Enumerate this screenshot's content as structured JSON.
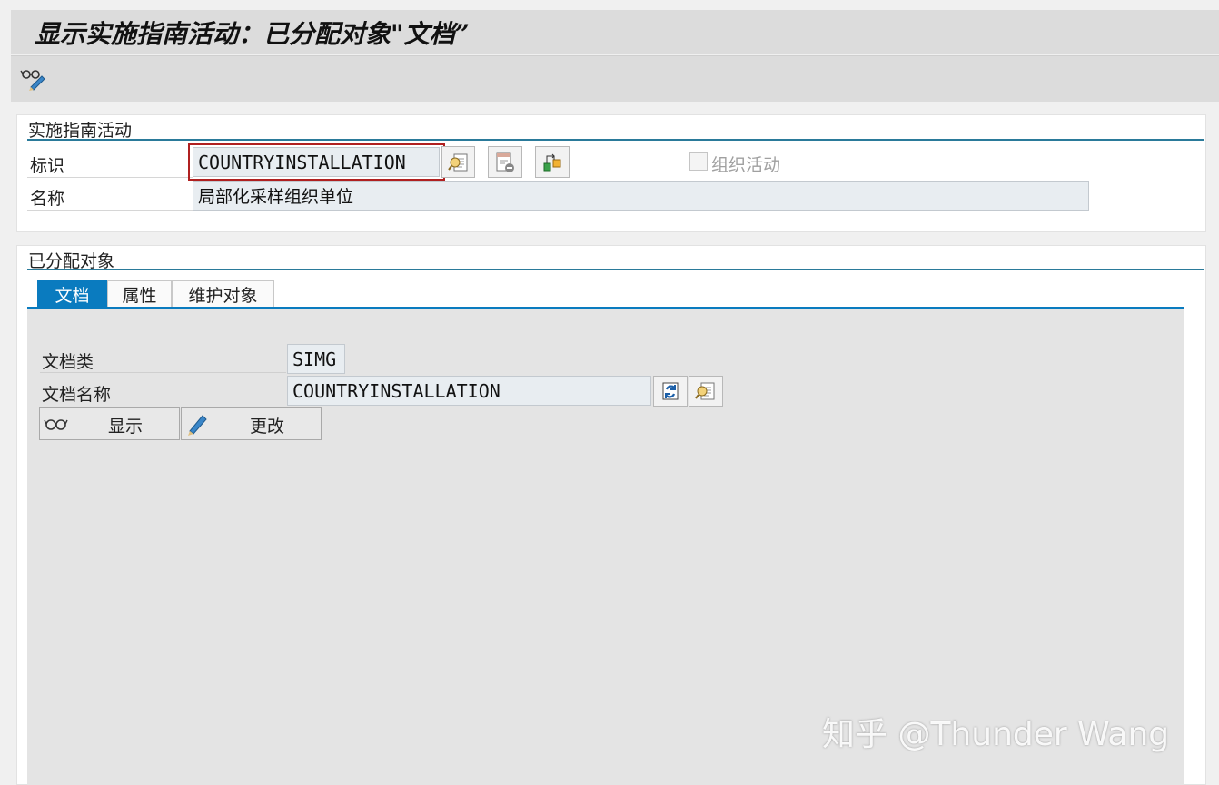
{
  "window": {
    "title": "显示实施指南活动：已分配对象\"文档”"
  },
  "toolbar": {
    "display_change_icon": "glasses-pencil-icon"
  },
  "section_activity": {
    "title": "实施指南活动",
    "id_label": "标识",
    "id_value": "COUNTRYINSTALLATION",
    "name_label": "名称",
    "name_value": "局部化采样组织单位",
    "org_activity_label": "组织活动",
    "org_activity_checked": false
  },
  "section_objects": {
    "title": "已分配对象",
    "tabs": [
      {
        "label": "文档",
        "active": true
      },
      {
        "label": "属性",
        "active": false
      },
      {
        "label": "维护对象",
        "active": false
      }
    ],
    "doc_class_label": "文档类",
    "doc_class_value": "SIMG",
    "doc_name_label": "文档名称",
    "doc_name_value": "COUNTRYINSTALLATION",
    "display_button": "显示",
    "change_button": "更改"
  },
  "colors": {
    "accent": "#0a7bbf",
    "section_line": "#2a7a9a",
    "focus": "#b02020"
  },
  "watermark": "知乎 @Thunder Wang"
}
